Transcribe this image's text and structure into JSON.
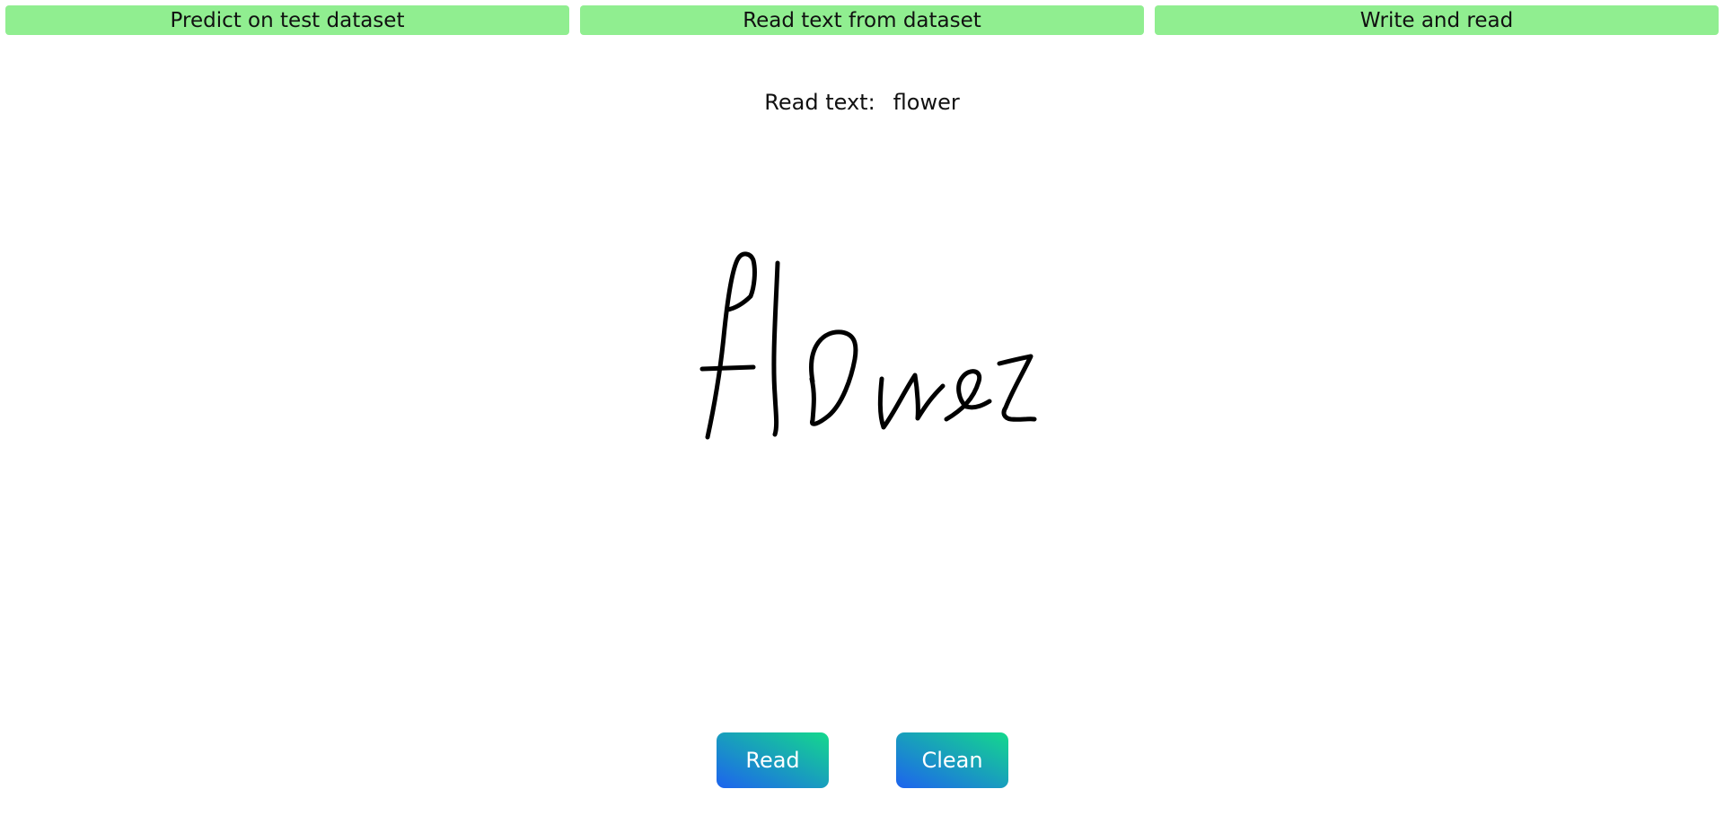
{
  "tabs": [
    {
      "label": "Predict on test dataset"
    },
    {
      "label": "Read text from dataset"
    },
    {
      "label": "Write and read"
    }
  ],
  "result": {
    "label": "Read text:",
    "value": "flower"
  },
  "canvas": {
    "stroke_color": "#000000",
    "background": "#ffffff"
  },
  "buttons": {
    "read_label": "Read",
    "clean_label": "Clean"
  },
  "colors": {
    "tab_background": "#90ee90",
    "button_gradient_start": "#1d63ef",
    "button_gradient_end": "#14d98c",
    "button_text": "#ffffff"
  }
}
